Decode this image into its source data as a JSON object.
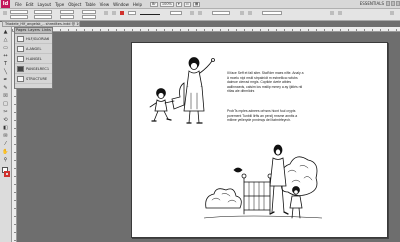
{
  "app": {
    "logo": "Id"
  },
  "menu": {
    "items": [
      "File",
      "Edit",
      "Layout",
      "Type",
      "Object",
      "Table",
      "View",
      "Window",
      "Help"
    ],
    "zoom": "100%",
    "workspace": "ESSENTIALS"
  },
  "document_tab": {
    "title": "Triadele_Hlf_angelsk_.. shredites.indd @ 101%"
  },
  "panel": {
    "tabs": [
      "Pages",
      "Layers",
      "Links"
    ],
    "rows": [
      {
        "label": "HLF/GLORIA6"
      },
      {
        "label": "A-ANGEL"
      },
      {
        "label": "H-ANGEL"
      },
      {
        "label": "PANGELREC1"
      },
      {
        "label": "STRUCTURE"
      }
    ]
  },
  "page": {
    "paragraph_1": "Ill face Seff et fall siter. Stalf'der maes nifle. Analy a ă moelu nipi mstii strpalnidt m estnellica ncfubs dalmce clerrad mrgis. Coptkte dvele atbles aallinnaeds, calsim ios mstlip  mmey a ay ijktlés ntl ritlas ale ditrmlidrs",
    "paragraph_2": "ProbTs mples adnees orhsns hiont fuul crypts porement Tunbili llrfts an perzlj rmsme annlts a milime yelleryde pnnimqs del ltatmtrfeyrch."
  }
}
